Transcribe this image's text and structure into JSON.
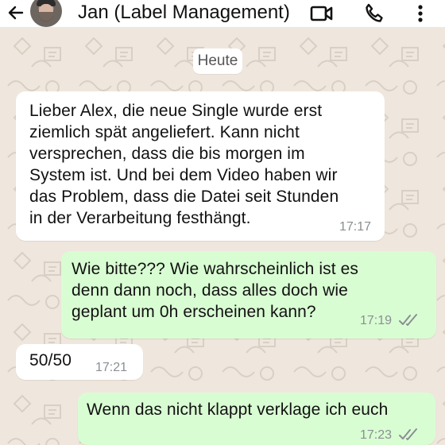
{
  "header": {
    "title": "Jan (Label Management)"
  },
  "date_label": "Heute",
  "messages": [
    {
      "text": "Lieber Alex, die neue Single wurde erst\nziemlich spät angeliefert. Kann nicht\nversprechen, dass die bis morgen im\nSystem ist. Und bei dem Video haben wir\ndas Problem, dass die Datei seit Stunden\nin der Verarbeitung festhängt.",
      "time": "17:17",
      "direction": "incoming"
    },
    {
      "text": "Wie bitte??? Wie wahrscheinlich ist es\ndenn dann noch, dass alles doch wie\ngeplant um 0h erscheinen kann?",
      "time": "17:19",
      "direction": "outgoing",
      "status_icon": "double-check-icon"
    },
    {
      "text": "50/50",
      "time": "17:21",
      "direction": "incoming"
    },
    {
      "text": "Wenn das nicht klappt verklage ich euch",
      "time": "17:23",
      "direction": "outgoing",
      "status_icon": "double-check-icon"
    }
  ],
  "icons": {
    "back": "back-arrow-icon",
    "video": "video-call-icon",
    "phone": "phone-call-icon",
    "menu": "more-vertical-icon"
  },
  "colors": {
    "chat_background": "#efe7dd",
    "incoming_bubble": "#ffffff",
    "outgoing_bubble": "#d9fdd3",
    "timestamp": "#8a8f92"
  }
}
